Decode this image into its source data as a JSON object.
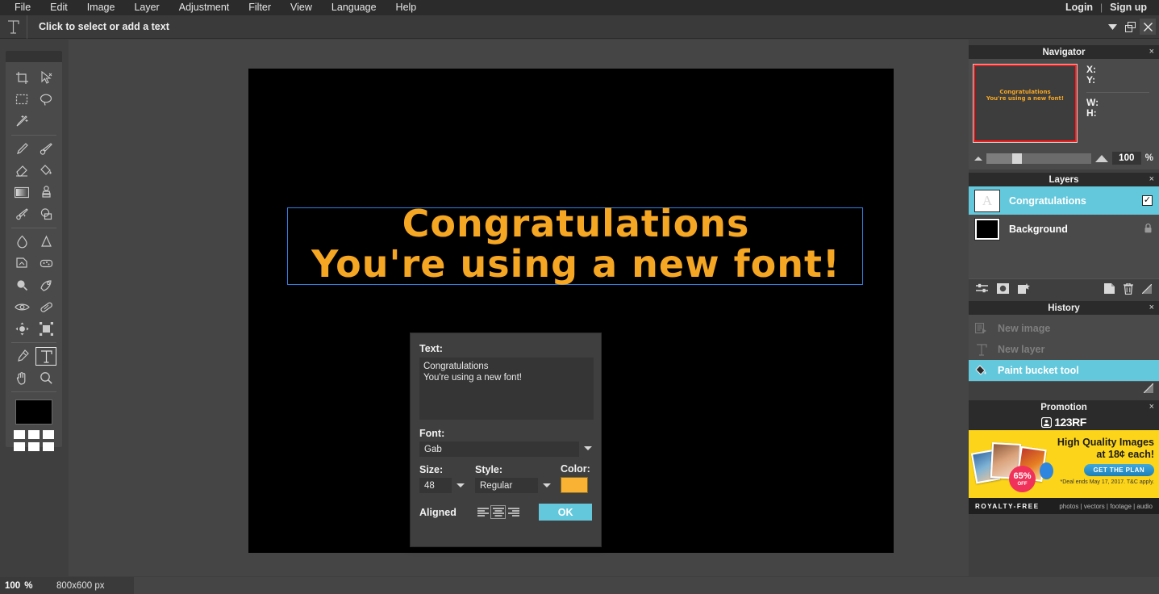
{
  "menubar": {
    "items": [
      "File",
      "Edit",
      "Image",
      "Layer",
      "Adjustment",
      "Filter",
      "View",
      "Language",
      "Help"
    ],
    "login": "Login",
    "separator": "|",
    "signup": "Sign up"
  },
  "options_bar": {
    "tool_icon": "text-tool-icon",
    "hint": "Click to select or add a text",
    "window_buttons": [
      "chevron-down-icon",
      "restore-icon",
      "close-icon"
    ]
  },
  "toolbox": {
    "tools": [
      {
        "name": "crop-tool",
        "selected": false
      },
      {
        "name": "move-tool",
        "selected": false
      },
      {
        "name": "rectangle-select-tool",
        "selected": false
      },
      {
        "name": "lasso-select-tool",
        "selected": false
      },
      {
        "name": "magic-wand-tool",
        "selected": false
      },
      {
        "name": "pencil-tool",
        "selected": false
      },
      {
        "name": "brush-tool",
        "selected": false
      },
      {
        "name": "eraser-tool",
        "selected": false
      },
      {
        "name": "paint-bucket-tool",
        "selected": false
      },
      {
        "name": "gradient-tool",
        "selected": false
      },
      {
        "name": "clone-stamp-tool",
        "selected": false
      },
      {
        "name": "smudge-tool",
        "selected": false
      },
      {
        "name": "shape-tool",
        "selected": false
      },
      {
        "name": "blur-tool",
        "selected": false
      },
      {
        "name": "sharpen-tool",
        "selected": false
      },
      {
        "name": "dodge-tool",
        "selected": false
      },
      {
        "name": "sponge-tool",
        "selected": false
      },
      {
        "name": "burn-tool",
        "selected": false
      },
      {
        "name": "marquee-tool",
        "selected": false
      },
      {
        "name": "red-eye-tool",
        "selected": false
      },
      {
        "name": "heal-tool",
        "selected": false
      },
      {
        "name": "warp-tool",
        "selected": false
      },
      {
        "name": "transform-tool",
        "selected": false
      },
      {
        "name": "eyedropper-tool",
        "selected": false
      },
      {
        "name": "text-tool",
        "selected": true
      },
      {
        "name": "hand-tool",
        "selected": false
      },
      {
        "name": "zoom-tool",
        "selected": false
      }
    ],
    "foreground_color": "#000000",
    "palette_colors": [
      "#ffffff",
      "#ffffff",
      "#ffffff",
      "#ffffff",
      "#ffffff",
      "#ffffff"
    ]
  },
  "canvas": {
    "background_color": "#000000",
    "selection_border_color": "#2f7fe0",
    "text": "Congratulations\nYou're using a new font!",
    "text_color": "#f5a623"
  },
  "text_dialog": {
    "text_label": "Text:",
    "text_value": "Congratulations\nYou're using a new font!",
    "font_label": "Font:",
    "font_value": "Gab",
    "size_label": "Size:",
    "size_value": "48",
    "style_label": "Style:",
    "style_value": "Regular",
    "color_label": "Color:",
    "color_value": "#f9b233",
    "aligned_label": "Aligned",
    "align_options": [
      "align-left",
      "align-center",
      "align-right"
    ],
    "align_selected": "align-center",
    "ok_label": "OK"
  },
  "navigator": {
    "title": "Navigator",
    "close": "×",
    "thumb_text": "Congratulations\nYou're using a new font!",
    "thumb_border_color": "#ff1a1a",
    "labels": {
      "x": "X:",
      "y": "Y:",
      "w": "W:",
      "h": "H:"
    },
    "zoom_value": "100",
    "zoom_unit": "%"
  },
  "layers": {
    "title": "Layers",
    "close": "×",
    "rows": [
      {
        "name": "Congratulations",
        "thumb": "A",
        "selected": true,
        "visible_check": "✓",
        "locked": false
      },
      {
        "name": "Background",
        "thumb": "",
        "selected": false,
        "visible_check": "",
        "locked": true
      }
    ],
    "footer_icons": [
      "layer-settings-icon",
      "layer-mask-icon",
      "layer-effects-icon",
      "duplicate-layer-icon",
      "delete-layer-icon",
      "resize-handle-icon"
    ]
  },
  "history": {
    "title": "History",
    "close": "×",
    "rows": [
      {
        "label": "New image",
        "icon": "new-image-icon",
        "selected": false,
        "dim": true
      },
      {
        "label": "New layer",
        "icon": "new-layer-icon",
        "selected": false,
        "dim": true
      },
      {
        "label": "Paint bucket tool",
        "icon": "paint-bucket-icon",
        "selected": true,
        "dim": false
      }
    ]
  },
  "promotion": {
    "title": "Promotion",
    "close": "×",
    "logo_text": "123RF",
    "headline_line1": "High Quality Images",
    "headline_line2": "at 18¢ each!",
    "cta": "GET THE PLAN",
    "fine_print": "*Deal ends May 17, 2017. T&C apply.",
    "badge_percent": "65%",
    "badge_off": "OFF",
    "footer_left": "ROYALTY-FREE",
    "footer_right": "photos | vectors | footage | audio"
  },
  "statusbar": {
    "zoom_value": "100",
    "zoom_unit": "%",
    "image_size": "800x600 px"
  }
}
